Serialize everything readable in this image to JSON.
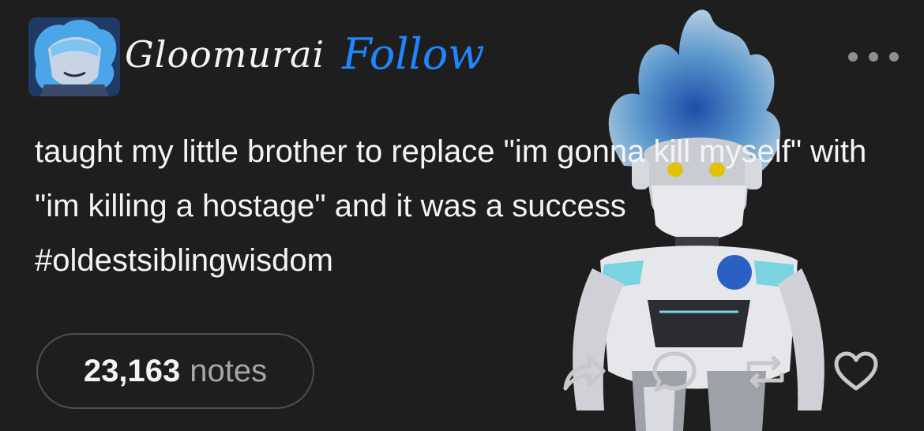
{
  "post": {
    "username": "Gloomurai",
    "follow_label": "Follow",
    "text": "taught my little brother to replace \"im gonna kill myself\" with \"im killing a hostage\" and it was a success #oldestsiblingwisdom",
    "notes_count": "23,163",
    "notes_label": "notes"
  },
  "icons": {
    "more": "more-options-icon",
    "share": "share-icon",
    "reply": "reply-icon",
    "reblog": "reblog-icon",
    "like": "heart-icon"
  },
  "colors": {
    "background": "#1e1e1e",
    "follow": "#1f86ff",
    "text": "#f4f4f4",
    "muted": "#a6a6a6"
  }
}
